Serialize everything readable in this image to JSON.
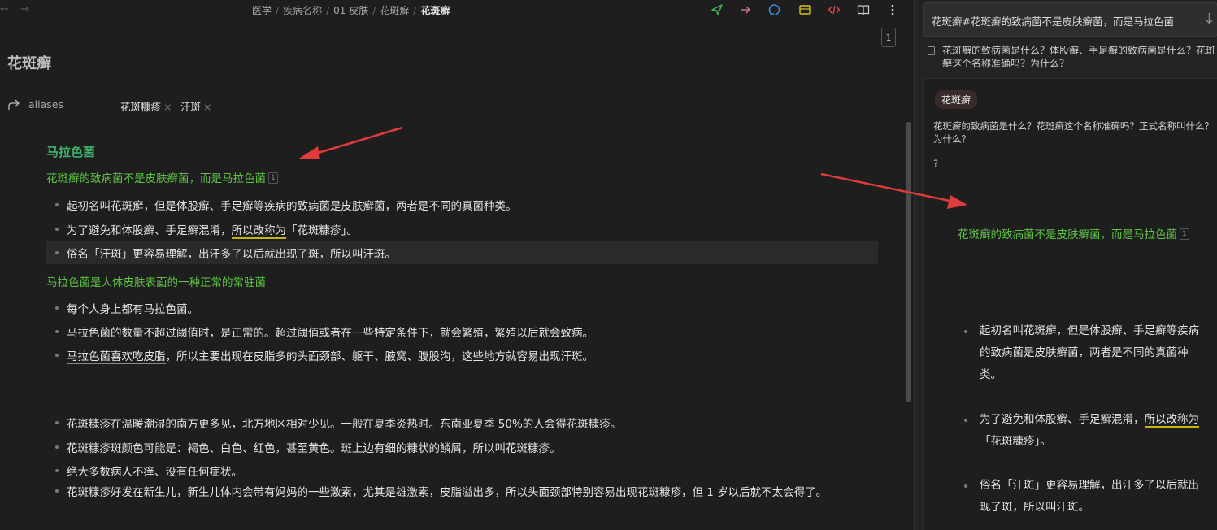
{
  "breadcrumb": {
    "items": [
      "医学",
      "疾病名称",
      "01 皮肤",
      "花斑癣"
    ],
    "current": "花斑癣",
    "separator": "/"
  },
  "nav": {
    "back_icon": "arrow-left-icon",
    "forward_icon": "arrow-right-icon"
  },
  "toolbar_icons": [
    "send-icon",
    "arrow-right-icon",
    "sync-icon",
    "card-icon",
    "code-icon",
    "book-open-icon",
    "more-vertical-icon"
  ],
  "tab_count": "1",
  "note": {
    "title": "花斑癣",
    "aliases_key": "aliases",
    "aliases": [
      "花斑糠疹",
      "汗斑"
    ],
    "alias_remove": "×",
    "heading": "马拉色菌",
    "green_line_1": "花斑癣的致病菌不是皮肤癣菌，而是马拉色菌",
    "footnote_marker": "1",
    "bullets_1": [
      "起初名叫花斑癣，但是体股癣、手足癣等疾病的致病菌是皮肤癣菌，两者是不同的真菌种类。"
    ],
    "bullet_2": {
      "prefix": "为了避免和体股癣、手足癣混淆，",
      "underlined": "所以改称为",
      "suffix": "「花斑糠疹」。"
    },
    "bullet_3": "俗名「汗斑」更容易理解，出汗多了以后就出现了斑，所以叫汗斑。",
    "green_line_2": "马拉色菌是人体皮肤表面的一种正常的常驻菌",
    "bullets_2": [
      "每个人身上都有马拉色菌。",
      "马拉色菌的数量不超过阈值时，是正常的。超过阈值或者在一些特定条件下，就会繁殖，繁殖以后就会致病。"
    ],
    "bullet_sebum": {
      "underlined": "马拉色菌喜欢吃皮脂",
      "suffix": "，所以主要出现在皮脂多的头面颈部、躯干、腋窝、腹股沟，这些地方就容易出现汗斑。"
    },
    "bullets_3": [
      "花斑糠疹在温暖潮湿的南方更多见，北方地区相对少见。一般在夏季炎热时。东南亚夏季 50%的人会得花斑糠疹。",
      "花斑糠疹斑颜色可能是：褐色、白色、红色，甚至黄色。斑上边有细的糠状的鳞屑，所以叫花斑糠疹。",
      "绝大多数病人不痒、没有任何症状。",
      "花斑糠疹好发在新生儿，新生儿体内会带有妈妈的一些激素，尤其是雄激素，皮脂溢出多，所以头面颈部特别容易出现花斑糠疹，但 1 岁以后就不太会得了。"
    ]
  },
  "search": {
    "query": "花斑癣#花斑癣的致病菌不是皮肤癣菌，而是马拉色菌",
    "result_title": "花斑癣的致病菌是什么？体股癣、手足癣的致病菌是什么？花斑癣这个名称准确吗？为什么？",
    "card_tag": "花斑癣",
    "card_question": "花斑癣的致病菌是什么？花斑癣这个名称准确吗？正式名称叫什么？为什么？",
    "card_qmark": "?",
    "card_green": "花斑癣的致病菌不是皮肤癣菌，而是马拉色菌",
    "card_footnote": "1",
    "card_bullet_1": "起初名叫花斑癣，但是体股癣、手足癣等疾病的致病菌是皮肤癣菌，两者是不同的真菌种类。",
    "card_bullet_2": {
      "prefix": "为了避免和体股癣、手足癣混淆，",
      "underlined": "所以改称为",
      "suffix": "「花斑糠疹」。"
    },
    "card_bullet_3": "俗名「汗斑」更容易理解，出汗多了以后就出现了斑，所以叫汗斑。"
  },
  "colors": {
    "green_text": "#5dc445",
    "heading_green": "#3fb06b",
    "annotation_red": "#e23b3b",
    "underline_yellow": "#c7b316"
  }
}
